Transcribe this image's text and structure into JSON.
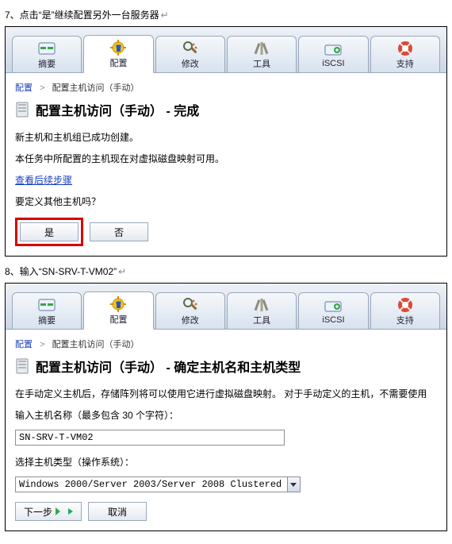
{
  "step7": {
    "caption": "7、点击“是”继续配置另外一台服务器",
    "tabs": [
      "摘要",
      "配置",
      "修改",
      "工具",
      "iSCSI",
      "支持"
    ],
    "active_tab_index": 1,
    "breadcrumb": {
      "root": "配置",
      "current": "配置主机访问（手动）"
    },
    "title": "配置主机访问（手动） - 完成",
    "msg1": "新主机和主机组已成功创建。",
    "msg2": "本任务中所配置的主机现在对虚拟磁盘映射可用。",
    "link_followup": "查看后续步骤",
    "prompt": "要定义其他主机吗？",
    "yes": "是",
    "no": "否"
  },
  "step8": {
    "caption": "8、输入“SN-SRV-T-VM02”",
    "tabs": [
      "摘要",
      "配置",
      "修改",
      "工具",
      "iSCSI",
      "支持"
    ],
    "active_tab_index": 1,
    "breadcrumb": {
      "root": "配置",
      "current": "配置主机访问（手动）"
    },
    "title": "配置主机访问（手动） - 确定主机名和主机类型",
    "intro": "在手动定义主机后，存储阵列将可以使用它进行虚拟磁盘映射。 对于手动定义的主机，不需要使用",
    "hostname_label": "输入主机名称（最多包含 30 个字符）：",
    "hostname_value": "SN-SRV-T-VM02",
    "hosttype_label": "选择主机类型（操作系统）：",
    "hosttype_value": "Windows 2000/Server 2003/Server 2008 Clustered",
    "next": "下一步",
    "cancel": "取消"
  },
  "icons": {
    "summary": "summary-icon",
    "configure": "configure-icon",
    "modify": "modify-icon",
    "tools": "tools-icon",
    "iscsi": "iscsi-icon",
    "support": "support-icon"
  }
}
